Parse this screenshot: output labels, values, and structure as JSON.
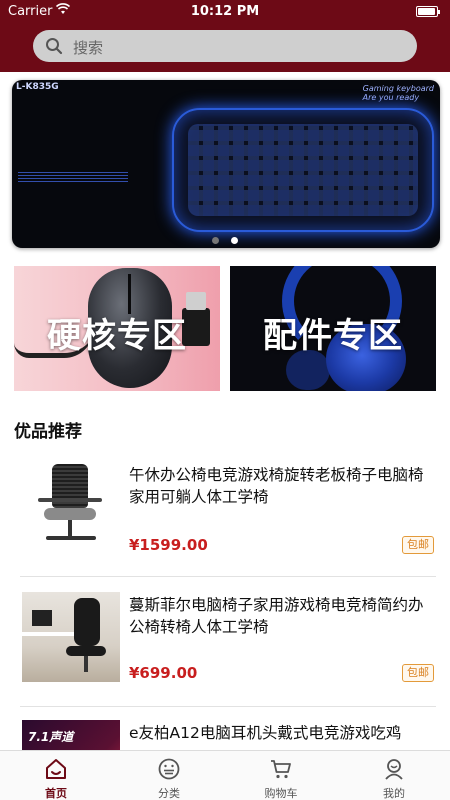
{
  "status_bar": {
    "carrier": "Carrier",
    "time": "10:12 PM"
  },
  "search": {
    "placeholder": "搜索"
  },
  "banner": {
    "model": "L-K835G",
    "brand": "Gaming keyboard",
    "brand_sub": "Are you ready",
    "page_count": 2,
    "active_page": 2
  },
  "zones": [
    {
      "label": "硬核专区"
    },
    {
      "label": "配件专区"
    }
  ],
  "section_title": "优品推荐",
  "products": [
    {
      "title": "午休办公椅电竞游戏椅旋转老板椅子电脑椅家用可躺人体工学椅",
      "price": "¥1599.00",
      "tag": "包邮"
    },
    {
      "title": "蔓斯菲尔电脑椅子家用游戏椅电竞椅简约办公椅转椅人体工学椅",
      "price": "¥699.00",
      "tag": "包邮"
    },
    {
      "title": "e友柏A12电脑耳机头戴式电竞游戏吃鸡",
      "thumb_text": "7.1声道",
      "price": "",
      "tag": ""
    }
  ],
  "tabbar": [
    {
      "label": "首页",
      "icon": "home-icon",
      "active": true
    },
    {
      "label": "分类",
      "icon": "category-icon",
      "active": false
    },
    {
      "label": "购物车",
      "icon": "cart-icon",
      "active": false
    },
    {
      "label": "我的",
      "icon": "profile-icon",
      "active": false
    }
  ],
  "colors": {
    "header": "#6d0a16",
    "price": "#c81e1e",
    "tag": "#d9801f",
    "active_tab": "#6d0a16"
  }
}
